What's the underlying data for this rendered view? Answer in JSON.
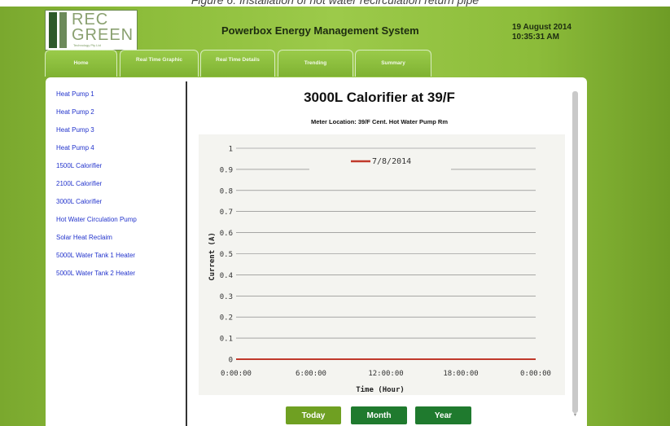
{
  "caption": "Figure 6: Installation of hot water recirculation return pipe",
  "logo": {
    "line1": "REC",
    "line2": "GREEN",
    "tagline": "Technology Pty Ltd"
  },
  "header": {
    "title": "Powerbox Energy Management System",
    "date": "19 August 2014",
    "time": "10:35:31 AM"
  },
  "tabs": [
    {
      "label": "Home"
    },
    {
      "label": "Real Time Graphic"
    },
    {
      "label": "Real Time Details"
    },
    {
      "label": "Trending"
    },
    {
      "label": "Summary"
    }
  ],
  "sidebar": {
    "items": [
      {
        "label": "Heat Pump 1"
      },
      {
        "label": "Heat Pump 2"
      },
      {
        "label": "Heat Pump 3"
      },
      {
        "label": "Heat Pump 4"
      },
      {
        "label": "1500L Calorifier"
      },
      {
        "label": "2100L Calorifier"
      },
      {
        "label": "3000L Calorifier"
      },
      {
        "label": "Hot Water Circulation Pump"
      },
      {
        "label": "Solar Heat Reclaim"
      },
      {
        "label": "5000L Water Tank 1 Heater"
      },
      {
        "label": "5000L Water Tank 2 Heater"
      }
    ]
  },
  "chart_header": {
    "title": "3000L Calorifier at 39/F",
    "subtitle": "Meter Location: 39/F Cent. Hot Water Pump Rm"
  },
  "chart_data": {
    "type": "line",
    "title": "3000L Calorifier at 39/F",
    "xlabel": "Time (Hour)",
    "ylabel": "Current (A)",
    "ylim": [
      0,
      1
    ],
    "yticks": [
      "0",
      "0.1",
      "0.2",
      "0.3",
      "0.4",
      "0.5",
      "0.6",
      "0.7",
      "0.8",
      "0.9",
      "1"
    ],
    "xticks": [
      "0:00:00",
      "6:00:00",
      "12:00:00",
      "18:00:00",
      "0:00:00"
    ],
    "grid": true,
    "legend": "top-center",
    "series": [
      {
        "name": "7/8/2014",
        "color": "#c0392b",
        "x": [
          "0:00:00",
          "24:00:00"
        ],
        "values": [
          0,
          0
        ]
      }
    ]
  },
  "buttons": {
    "today": "Today",
    "month": "Month",
    "year": "Year"
  },
  "colors": {
    "accent": "#7fb232",
    "button": "#1f7a2e",
    "button_active": "#6fa022",
    "link": "#2233cc"
  }
}
